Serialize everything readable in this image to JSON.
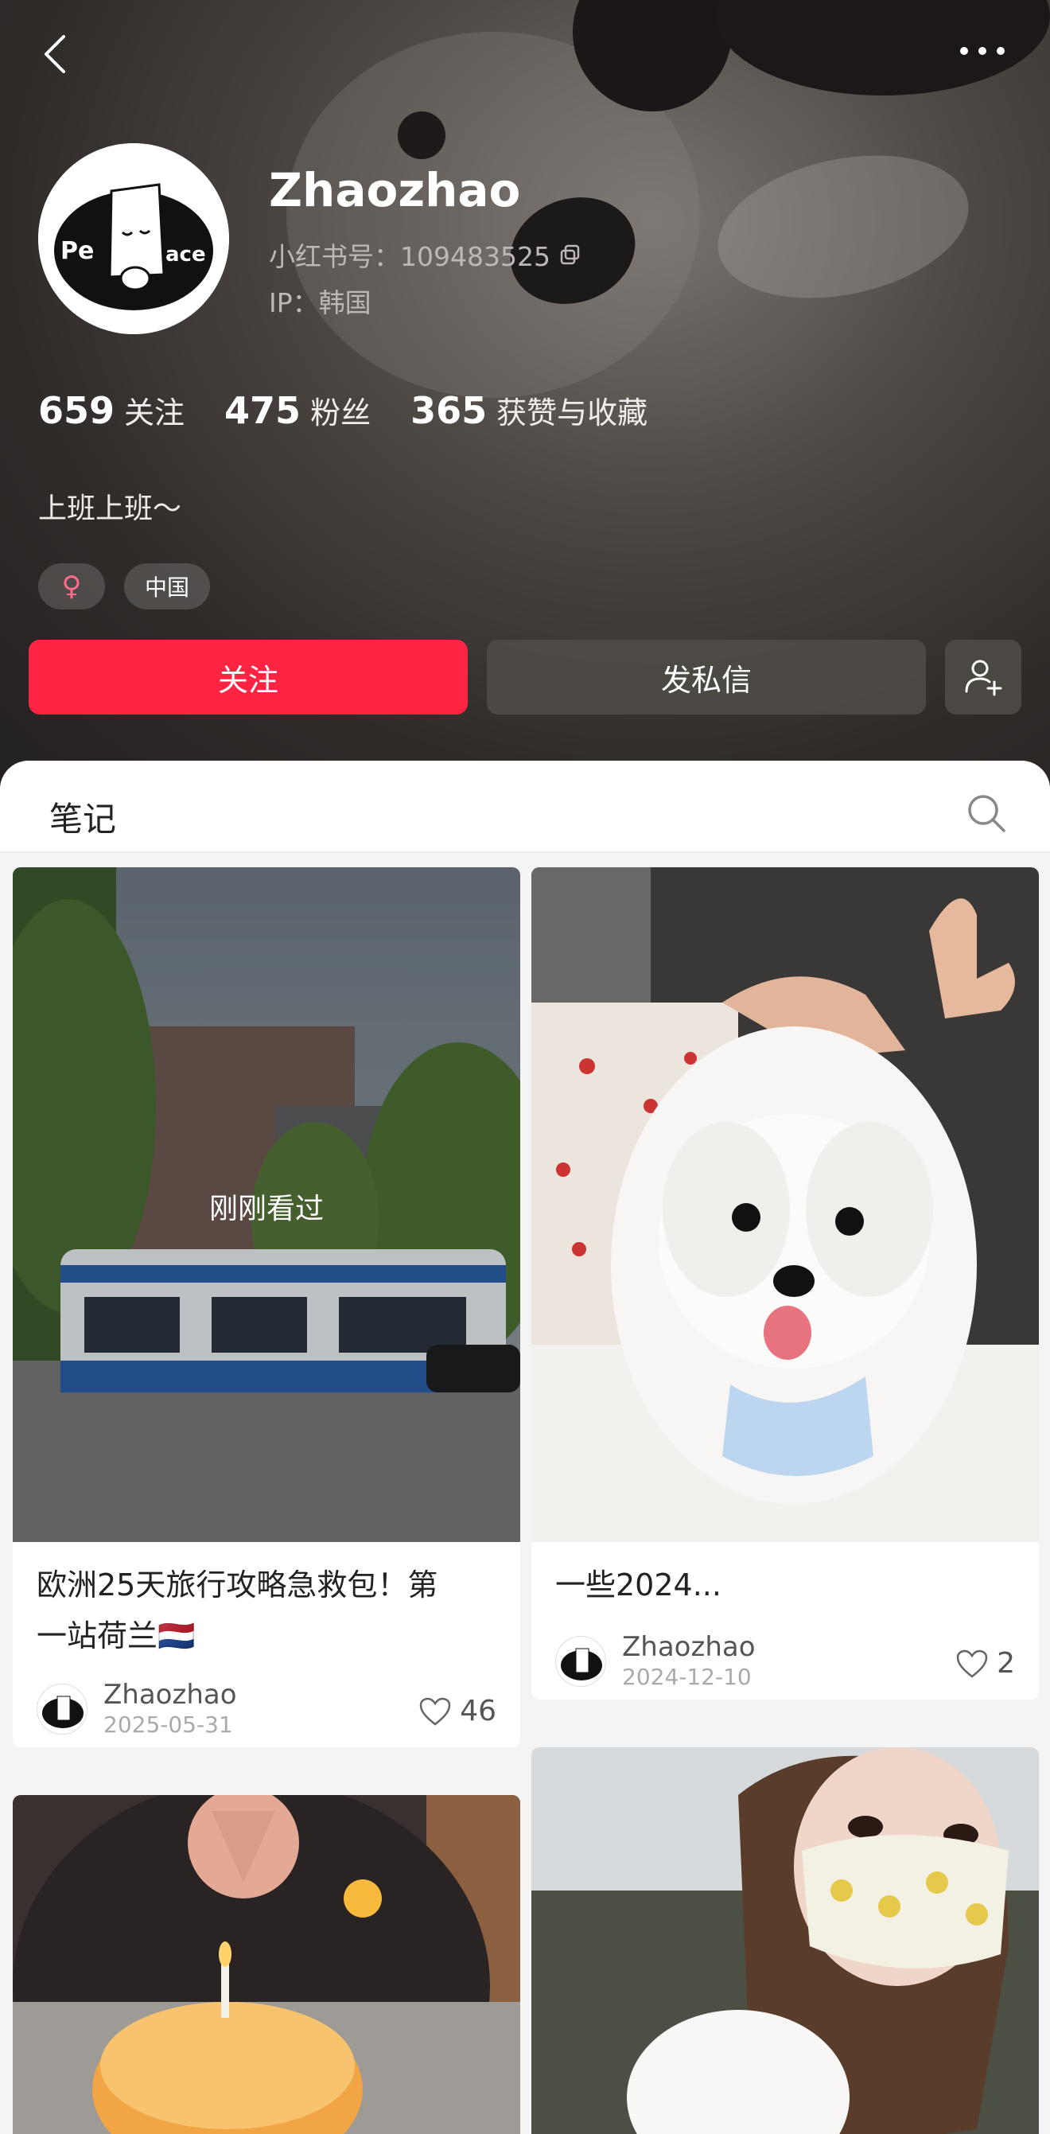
{
  "profile": {
    "name": "Zhaozhao",
    "redid": "小红书号：109483525",
    "ip": "IP：韩国",
    "bio": "上班上班～",
    "stats": [
      {
        "value": "659",
        "label": "关注"
      },
      {
        "value": "475",
        "label": "粉丝"
      },
      {
        "value": "365",
        "label": "获赞与收藏"
      }
    ],
    "tags": {
      "gender": "♀",
      "region": "中国"
    },
    "avatar_text": {
      "left": "Pe",
      "right": "ace"
    }
  },
  "actions": {
    "follow": "关注",
    "message": "发私信"
  },
  "notes_tab": {
    "label": "笔记"
  },
  "notes": [
    {
      "title_line1": "欧洲25天旅行攻略急救包！第",
      "title_line2": "一站荷兰🇳🇱",
      "overlay": "刚刚看过",
      "author": "Zhaozhao",
      "date": "2025-05-31",
      "likes": "46"
    },
    {
      "title_line1": "一些2024...",
      "author": "Zhaozhao",
      "date": "2024-12-10",
      "likes": "2"
    }
  ],
  "colors": {
    "accent": "#ff2442",
    "header_bg": "#2f2b29"
  }
}
